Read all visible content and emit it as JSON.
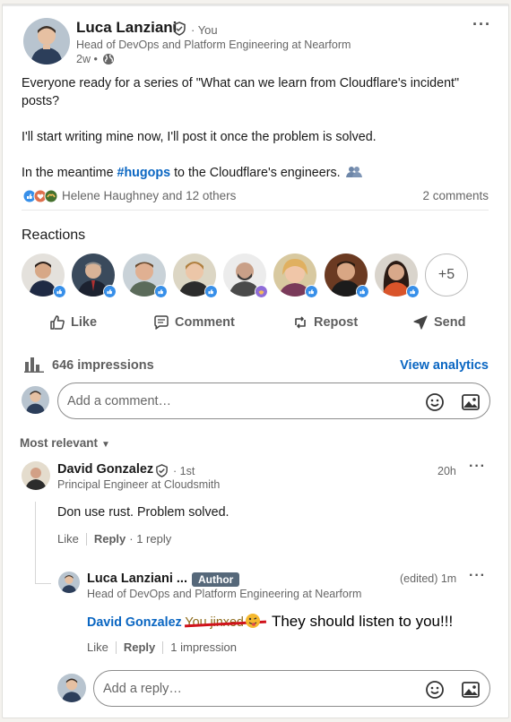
{
  "post": {
    "author_name": "Luca Lanziani",
    "you_label": "· You",
    "headline": "Head of DevOps and Platform Engineering at Nearform",
    "time": "2w •",
    "more_label": "···",
    "text_line1": "Everyone ready for a series of \"What can we learn from Cloudflare's incident\" posts?",
    "text_line2": "I'll start writing mine now, I'll post it once the problem is solved.",
    "text_line3_prefix": "In the meantime",
    "hashtag": "#hugops",
    "text_line3_suffix": "to the Cloudflare's engineers."
  },
  "social": {
    "reaction_names": "Helene Haughney and 12 others",
    "comments_count": "2 comments"
  },
  "reactions": {
    "title": "Reactions",
    "more": "+5"
  },
  "actions": {
    "like": "Like",
    "comment": "Comment",
    "repost": "Repost",
    "send": "Send"
  },
  "analytics": {
    "impressions": "646 impressions",
    "view": "View analytics"
  },
  "comment_box": {
    "placeholder": "Add a comment…"
  },
  "sort": {
    "label": "Most relevant"
  },
  "comment1": {
    "name": "David Gonzalez",
    "degree": "· 1st",
    "headline": "Principal Engineer at Cloudsmith",
    "time": "20h",
    "text": "Don use rust. Problem solved.",
    "like": "Like",
    "reply": "Reply",
    "replies": "· 1 reply"
  },
  "reply1": {
    "name": "Luca Lanziani ...",
    "badge": "Author",
    "headline": "Head of DevOps and Platform Engineering at Nearform",
    "time": "(edited) 1m",
    "mention": "David Gonzalez",
    "struck": "You jinxed it",
    "added": "They should listen to you!!!",
    "like": "Like",
    "reply": "Reply",
    "impressions": "1 impression"
  },
  "reply_box": {
    "placeholder": "Add a reply…"
  },
  "colors": {
    "link": "#0a66c2",
    "author_badge": "#56687a",
    "strike": "#d0121b"
  }
}
